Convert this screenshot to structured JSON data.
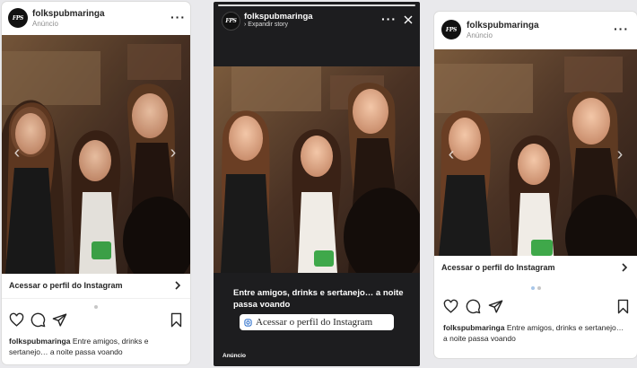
{
  "account": {
    "username": "folkspubmaringa",
    "sponsored": "Anúncio",
    "logo_text": "FPS"
  },
  "feed_card": {
    "cta_label": "Acessar o perfil do Instagram",
    "caption_user": "folkspubmaringa",
    "caption_text": "Entre amigos, drinks e sertanejo… a noite passa voando"
  },
  "story": {
    "expand_label": "› Expandir story",
    "caption": "Entre amigos, drinks e sertanejo… a noite passa voando",
    "cta_label": "Acessar o perfil do Instagram",
    "sponsored": "Anúncio"
  },
  "colors": {
    "story_bg": "#1d1d1f",
    "card_bg": "#ffffff",
    "page_bg": "#e9e9ec",
    "carousel_dot_active": "#a8c6e8"
  },
  "icons": [
    "heart-icon",
    "comment-icon",
    "share-icon",
    "bookmark-icon",
    "more-icon",
    "close-icon",
    "chevron-right-icon",
    "instagram-icon"
  ]
}
